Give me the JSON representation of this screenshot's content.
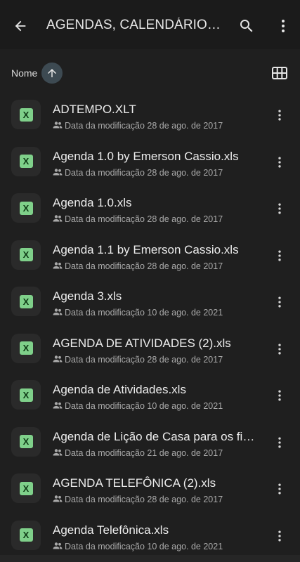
{
  "appbar": {
    "title": "AGENDAS, CALENDÁRIOS,...",
    "back_icon": "arrow-back-icon",
    "search_icon": "search-icon",
    "more_icon": "more-vert-icon"
  },
  "sort": {
    "label": "Nome",
    "direction": "ascending",
    "direction_icon": "arrow-up-icon",
    "view_toggle_icon": "grid-view-icon"
  },
  "files": [
    {
      "name": "ADTEMPO.XLT",
      "meta": "Data da modificação 28 de ago. de 2017",
      "type_glyph": "X"
    },
    {
      "name": "Agenda 1.0 by Emerson Cassio.xls",
      "meta": "Data da modificação 28 de ago. de 2017",
      "type_glyph": "X"
    },
    {
      "name": "Agenda 1.0.xls",
      "meta": "Data da modificação 28 de ago. de 2017",
      "type_glyph": "X"
    },
    {
      "name": "Agenda 1.1 by Emerson Cassio.xls",
      "meta": "Data da modificação 28 de ago. de 2017",
      "type_glyph": "X"
    },
    {
      "name": "Agenda 3.xls",
      "meta": "Data da modificação 10 de ago. de 2021",
      "type_glyph": "X"
    },
    {
      "name": "AGENDA DE ATIVIDADES (2).xls",
      "meta": "Data da modificação 28 de ago. de 2017",
      "type_glyph": "X"
    },
    {
      "name": "Agenda de Atividades.xls",
      "meta": "Data da modificação 10 de ago. de 2021",
      "type_glyph": "X"
    },
    {
      "name": "Agenda de Lição de Casa para os fil...",
      "meta": "Data da modificação 21 de ago. de 2017",
      "type_glyph": "X"
    },
    {
      "name": "AGENDA TELEFÔNICA (2).xls",
      "meta": "Data da modificação 28 de ago. de 2017",
      "type_glyph": "X"
    },
    {
      "name": "Agenda Telefônica.xls",
      "meta": "Data da modificação 10 de ago. de 2021",
      "type_glyph": "X"
    }
  ],
  "colors": {
    "background": "#1f1f1f",
    "sheet_icon": "#7fd08a",
    "sort_chip": "#3d4a52"
  }
}
